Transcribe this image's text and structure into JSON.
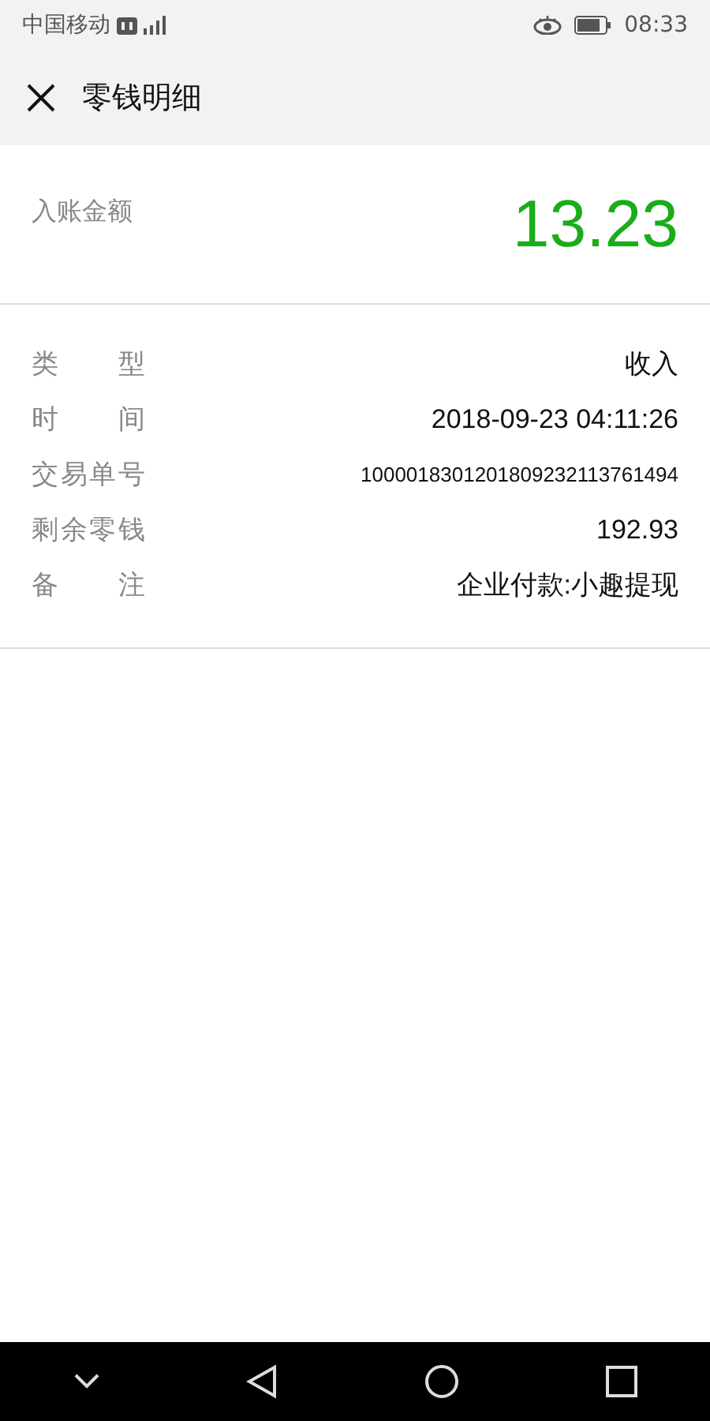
{
  "status_bar": {
    "carrier": "中国移动",
    "time": "08:33"
  },
  "header": {
    "title": "零钱明细"
  },
  "amount": {
    "label": "入账金额",
    "value": "13.23"
  },
  "details": [
    {
      "label": "类 型",
      "value": "收入"
    },
    {
      "label": "时 间",
      "value": "2018-09-23 04:11:26"
    },
    {
      "label": "交易单号",
      "value": "1000018301201809232113761494",
      "kind": "small"
    },
    {
      "label": "剩余零钱",
      "value": "192.93"
    },
    {
      "label": "备 注",
      "value": "企业付款:小趣提现"
    }
  ]
}
